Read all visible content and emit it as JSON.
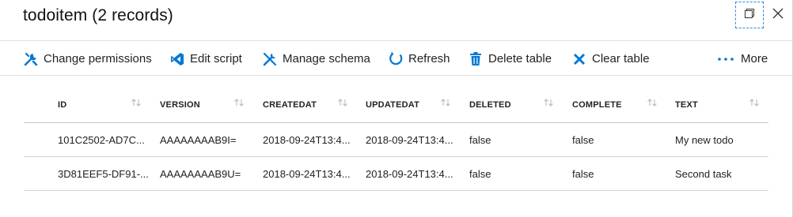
{
  "header": {
    "title": "todoitem (2 records)"
  },
  "toolbar": {
    "items": [
      {
        "label": "Change permissions",
        "icon": "wrench-icon"
      },
      {
        "label": "Edit script",
        "icon": "visual-studio-icon"
      },
      {
        "label": "Manage schema",
        "icon": "tools-icon"
      },
      {
        "label": "Refresh",
        "icon": "refresh-icon"
      },
      {
        "label": "Delete table",
        "icon": "trash-icon"
      },
      {
        "label": "Clear table",
        "icon": "x-icon"
      },
      {
        "label": "More",
        "icon": "ellipsis-icon"
      }
    ]
  },
  "table": {
    "columns": [
      "ID",
      "VERSION",
      "CREATEDAT",
      "UPDATEDAT",
      "DELETED",
      "COMPLETE",
      "TEXT"
    ],
    "rows": [
      [
        "101C2502-AD7C...",
        "AAAAAAAAB9I=",
        "2018-09-24T13:4...",
        "2018-09-24T13:4...",
        "false",
        "false",
        "My new todo"
      ],
      [
        "3D81EEF5-DF91-...",
        "AAAAAAAAB9U=",
        "2018-09-24T13:4...",
        "2018-09-24T13:4...",
        "false",
        "false",
        "Second task"
      ]
    ]
  },
  "colors": {
    "accent": "#0078d4",
    "border": "#e1e1e1",
    "focus": "#2b88d8"
  }
}
